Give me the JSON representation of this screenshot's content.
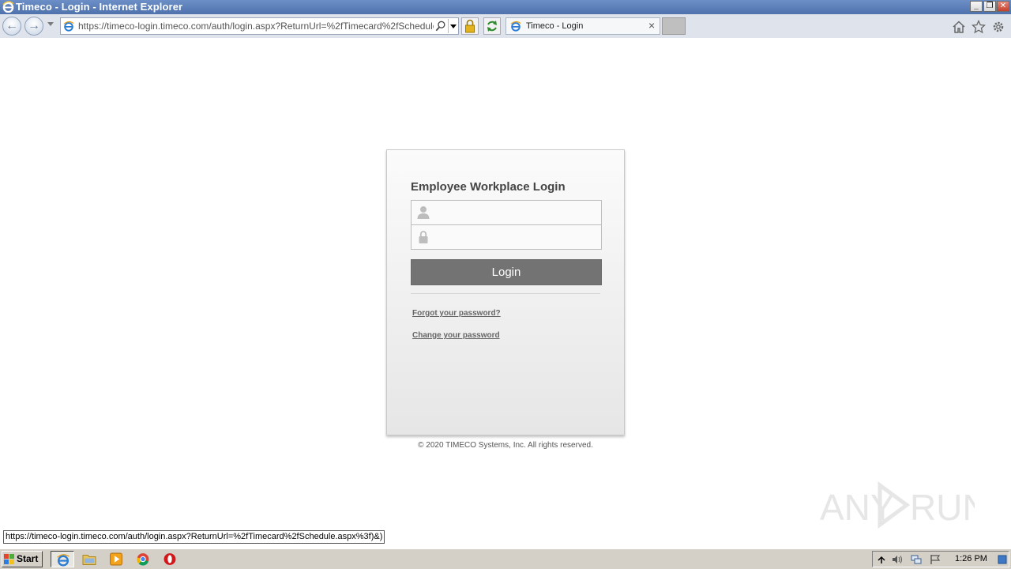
{
  "window": {
    "title": "Timeco - Login - Internet Explorer"
  },
  "browser": {
    "url": "https://timeco-login.timeco.com/auth/login.aspx?ReturnUrl=%2fTimecard%2fSchedule.aspx",
    "tab_title": "Timeco - Login",
    "tab_close": "×"
  },
  "login": {
    "heading": "Employee Workplace Login",
    "username_value": "",
    "password_value": "",
    "login_button": "Login",
    "forgot_link": "Forgot your password?",
    "change_link": "Change your password",
    "copyright": "© 2020 TIMECO Systems, Inc. All rights reserved."
  },
  "status_bar": {
    "url": "https://timeco-login.timeco.com/auth/login.aspx?ReturnUrl=%2fTimecard%2fSchedule.aspx%3f)&)"
  },
  "watermark": {
    "text": "ANY RUN"
  },
  "taskbar": {
    "start_label": "Start",
    "clock": "1:26 PM",
    "apps": [
      "internet-explorer",
      "file-explorer",
      "media-player",
      "chrome",
      "opera"
    ]
  },
  "colors": {
    "titlebar": "#4f72ad",
    "login_button": "#737373",
    "link": "#666666"
  }
}
